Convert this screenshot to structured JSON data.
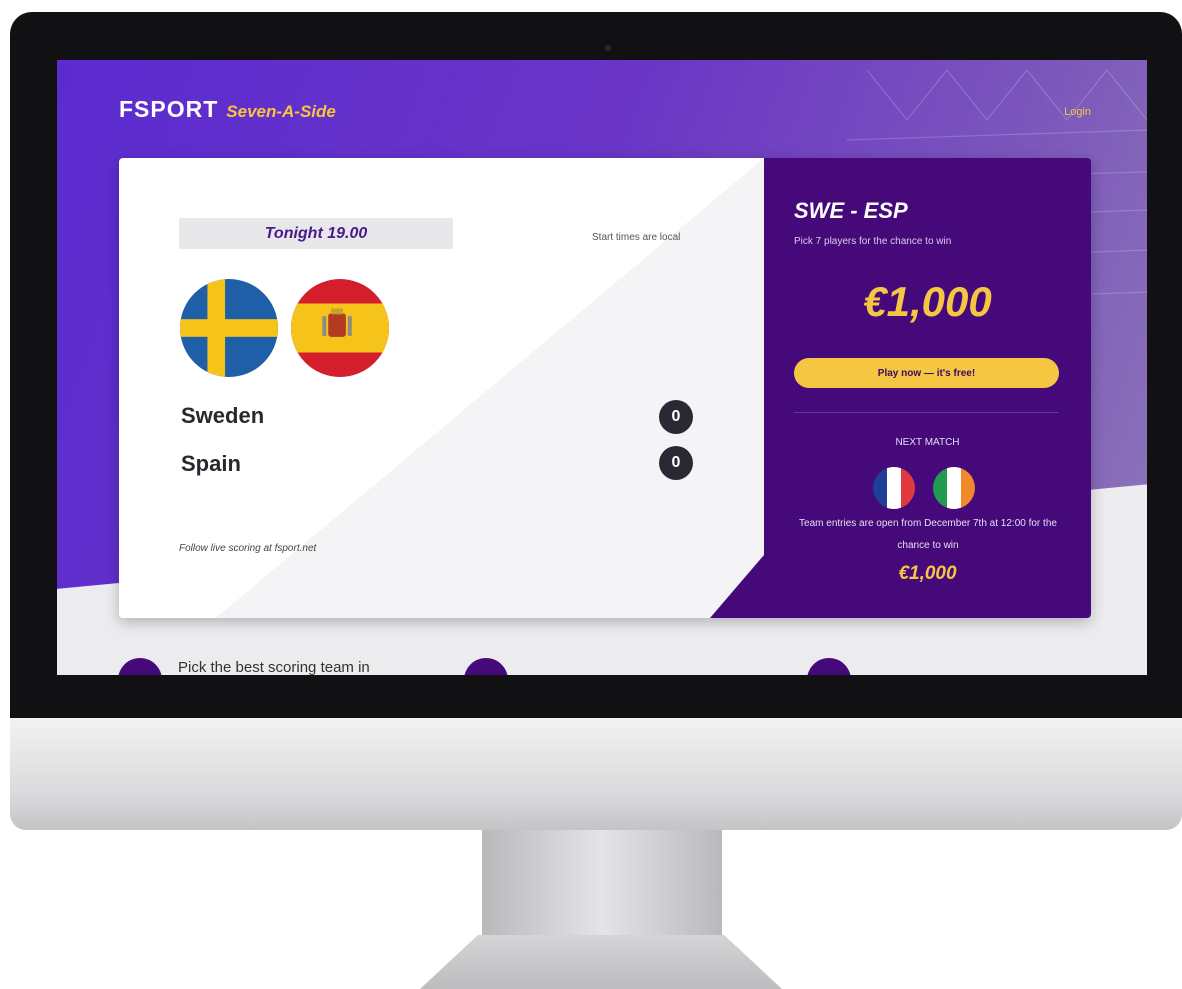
{
  "header": {
    "logo": "FSPORT",
    "subtitle": "Seven-A-Side",
    "login": "Login"
  },
  "match": {
    "time": "Tonight 19.00",
    "start_note": "Start times are local",
    "teams": [
      {
        "name": "Sweden",
        "score": "0",
        "flag": "sweden-flag-icon"
      },
      {
        "name": "Spain",
        "score": "0",
        "flag": "spain-flag-icon"
      }
    ],
    "follow_note": "Follow live scoring at fsport.net"
  },
  "promo": {
    "title": "SWE - ESP",
    "pick_note": "Pick 7 players for the chance to win",
    "prize": "€1,000",
    "cta": "Play now — it's free!",
    "next_label": "NEXT MATCH",
    "next_flags": [
      "france-flag-icon",
      "ireland-flag-icon"
    ],
    "entries_note": "Team entries are open from December 7th at 12:00 for the chance to win",
    "next_prize": "€1,000"
  },
  "steps": {
    "step1_text": "Pick the best scoring team in"
  },
  "colors": {
    "purple_dark": "#46097a",
    "purple_header": "#5b2bd0",
    "accent_yellow": "#f5c642",
    "score_dark": "#2c2833"
  }
}
